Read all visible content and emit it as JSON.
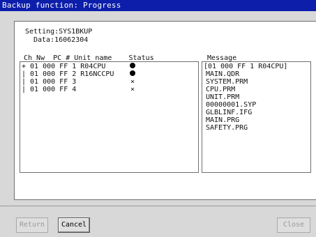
{
  "window": {
    "title": "Backup function: Progress"
  },
  "setting": {
    "setting_line": "Setting:SYS1BKUP",
    "data_line": "Data:16062304"
  },
  "table": {
    "header": "Ch Nw  PC # Unit name    Status",
    "rows": [
      {
        "text": "+ 01 000 FF 1 R04CPU",
        "status_icon": "filled-circle"
      },
      {
        "text": "| 01 000 FF 2 R16NCCPU",
        "status_icon": "filled-circle"
      },
      {
        "text": "| 01 000 FF 3",
        "status_icon": "x-mark",
        "status_text": "×"
      },
      {
        "text": "| 01 000 FF 4",
        "status_icon": "x-mark",
        "status_text": "×"
      }
    ]
  },
  "messages": {
    "header": "Message",
    "lines": [
      "[01 000 FF 1 R04CPU]",
      "MAIN.QDR",
      "SYSTEM.PRM",
      "CPU.PRM",
      "UNIT.PRM",
      "00000001.SYP",
      "GLBLINF.IFG",
      "MAIN.PRG",
      "SAFETY.PRG"
    ]
  },
  "buttons": {
    "return_label": "Return",
    "cancel_label": "Cancel",
    "close_label": "Close"
  }
}
